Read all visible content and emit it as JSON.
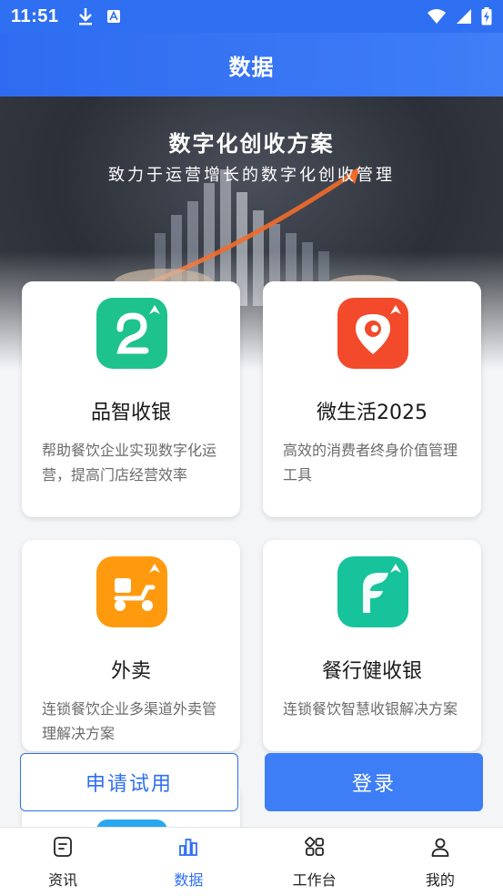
{
  "status_bar": {
    "time": "11:51"
  },
  "header": {
    "title": "数据"
  },
  "banner": {
    "title": "数字化创收方案",
    "subtitle": "致力于运营增长的数字化创收管理"
  },
  "products": [
    {
      "name": "品智收银",
      "desc": "帮助餐饮企业实现数字化运营，提高门店经营效率",
      "icon": "pinzhi-app-icon",
      "color": "#1ec28c"
    },
    {
      "name": "微生活2025",
      "desc": "高效的消费者终身价值管理工具",
      "icon": "weishenghuo-app-icon",
      "color": "#f24a2a"
    },
    {
      "name": "外卖",
      "desc": "连锁餐饮企业多渠道外卖管理解决方案",
      "icon": "delivery-scooter-app-icon",
      "color": "#ff9a0e"
    },
    {
      "name": "餐行健收银",
      "desc": "连锁餐饮智慧收银解决方案",
      "icon": "canxingjian-app-icon",
      "color": "#17c39a"
    }
  ],
  "actions": {
    "trial": "申请试用",
    "login": "登录"
  },
  "tabs": [
    {
      "label": "资讯",
      "icon": "news-icon",
      "active": false
    },
    {
      "label": "数据",
      "icon": "data-chart-icon",
      "active": true
    },
    {
      "label": "工作台",
      "icon": "workbench-grid-icon",
      "active": false
    },
    {
      "label": "我的",
      "icon": "profile-icon",
      "active": false
    }
  ],
  "colors": {
    "primary": "#2f6ff2",
    "active_tab": "#2f6ff2"
  }
}
